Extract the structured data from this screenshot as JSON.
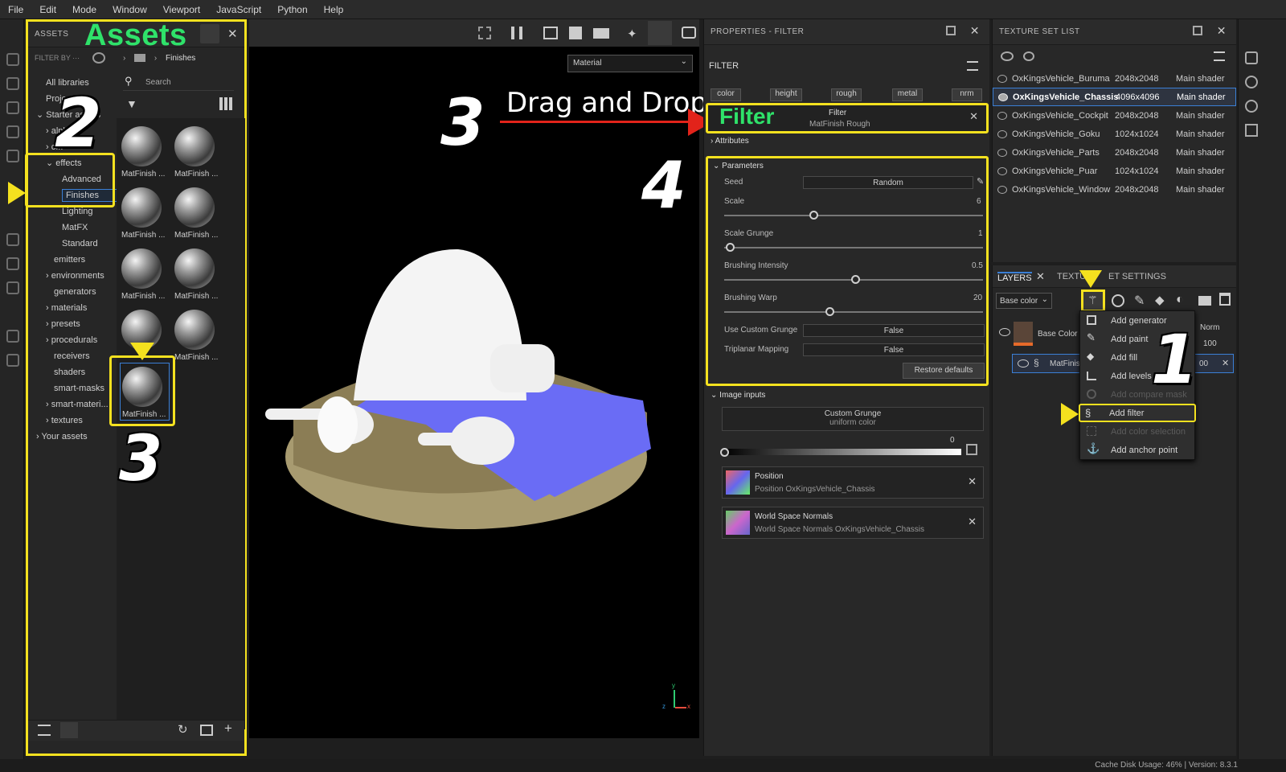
{
  "menu": [
    "File",
    "Edit",
    "Mode",
    "Window",
    "Viewport",
    "JavaScript",
    "Python",
    "Help"
  ],
  "assets": {
    "header": "ASSETS",
    "title": "Assets",
    "filter_by": "FILTER BY ···",
    "breadcrumb": "Finishes",
    "search_placeholder": "Search",
    "tree": [
      "All libraries",
      "Project",
      "Starter assets",
      "alpha",
      "c...",
      "effects",
      "Advanced",
      "Finishes",
      "Lighting",
      "MatFX",
      "Standard",
      "emitters",
      "environments",
      "generators",
      "materials",
      "presets",
      "procedurals",
      "receivers",
      "shaders",
      "smart-masks",
      "smart-materi...",
      "textures",
      "Your assets"
    ],
    "thumb_label": "MatFinish ...",
    "selected_thumb_label": "MatFinish ..."
  },
  "viewport": {
    "material_select": "Material",
    "axis_x": "x",
    "axis_y": "y",
    "axis_z": "z"
  },
  "properties": {
    "header": "PROPERTIES - FILTER",
    "section": "FILTER",
    "channels": [
      "color",
      "height",
      "rough",
      "metal",
      "nrm"
    ],
    "filter_card": {
      "title": "Filter",
      "subtitle": "MatFinish Rough",
      "big_label": "Filter"
    },
    "attributes": "Attributes",
    "parameters": "Parameters",
    "seed_label": "Seed",
    "seed_value": "Random",
    "scale_label": "Scale",
    "scale_value": "6",
    "scale_grunge_label": "Scale Grunge",
    "scale_grunge_value": "1",
    "brushing_intensity_label": "Brushing Intensity",
    "brushing_intensity_value": "0.5",
    "brushing_warp_label": "Brushing Warp",
    "brushing_warp_value": "20",
    "use_custom_grunge_label": "Use Custom Grunge",
    "use_custom_grunge_value": "False",
    "triplanar_label": "Triplanar Mapping",
    "triplanar_value": "False",
    "restore": "Restore defaults",
    "image_inputs": "Image inputs",
    "custom_grunge_title": "Custom Grunge",
    "custom_grunge_sub": "uniform color",
    "grunge_value": "0",
    "position_title": "Position",
    "position_sub": "Position OxKingsVehicle_Chassis",
    "wsn_title": "World Space Normals",
    "wsn_sub": "World Space Normals OxKingsVehicle_Chassis"
  },
  "texture_set": {
    "header": "TEXTURE SET LIST",
    "rows": [
      {
        "name": "OxKingsVehicle_Buruma",
        "res": "2048x2048",
        "shader": "Main shader"
      },
      {
        "name": "OxKingsVehicle_Chassis",
        "res": "4096x4096",
        "shader": "Main shader"
      },
      {
        "name": "OxKingsVehicle_Cockpit",
        "res": "2048x2048",
        "shader": "Main shader"
      },
      {
        "name": "OxKingsVehicle_Goku",
        "res": "1024x1024",
        "shader": "Main shader"
      },
      {
        "name": "OxKingsVehicle_Parts",
        "res": "2048x2048",
        "shader": "Main shader"
      },
      {
        "name": "OxKingsVehicle_Puar",
        "res": "1024x1024",
        "shader": "Main shader"
      },
      {
        "name": "OxKingsVehicle_Window",
        "res": "2048x2048",
        "shader": "Main shader"
      }
    ]
  },
  "layers": {
    "tab": "LAYERS",
    "tab2": "TEXTU",
    "tab2b": "ET SETTINGS",
    "channel": "Base color",
    "layer1": "Base Color",
    "layer2": "MatFinis",
    "blend": "Norm",
    "opacity": "100",
    "opacity2": "00",
    "menu": [
      {
        "label": "Add generator",
        "dim": false
      },
      {
        "label": "Add paint",
        "dim": false
      },
      {
        "label": "Add fill",
        "dim": false
      },
      {
        "label": "Add levels",
        "dim": false
      },
      {
        "label": "Add compare mask",
        "dim": true
      },
      {
        "label": "Add filter",
        "dim": false
      },
      {
        "label": "Add color selection",
        "dim": true
      },
      {
        "label": "Add anchor point",
        "dim": false
      }
    ]
  },
  "annotations": {
    "n1": "1",
    "n2": "2",
    "n3": "3",
    "n3b": "3",
    "n4": "4",
    "drag": "Drag and Drop"
  },
  "status": "Cache Disk Usage:   46% | Version: 8.3.1",
  "colors": {
    "highlight": "#f4e11f",
    "green": "#2fe26a",
    "arrow": "#e2231a",
    "accent": "#3b7fd6"
  }
}
